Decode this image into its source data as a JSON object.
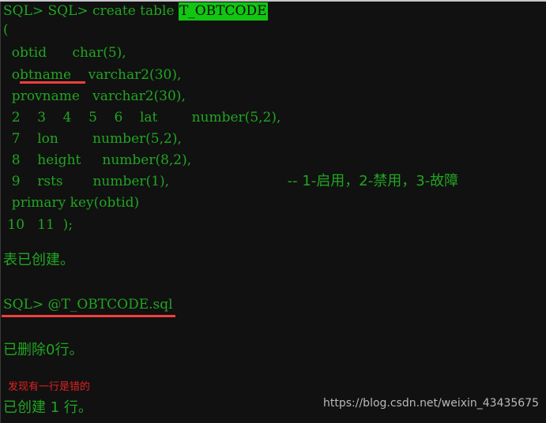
{
  "terminal": {
    "background_color": "#111111",
    "text_color": "#21a521",
    "highlight_bg_color": "#12c512",
    "highlight_fg_color": "#0c0c0c",
    "annotation_color": "#e02222",
    "underline_color": "#f0403c",
    "watermark_color": "#b9b9b9"
  },
  "lines": {
    "l1_prefix": "SQL> SQL> create table ",
    "l1_highlight": "T_OBTCODE",
    "l2": "(",
    "l3": "  obtid      char(5),",
    "l4_name": "  obtname",
    "l4_type": "    varchar2(30),",
    "l5": "  provname   varchar2(30),",
    "l6": "  2    3    4    5    6    lat        number(5,2),",
    "l7": "  7    lon        number(5,2),",
    "l8": "  8    height     number(8,2),",
    "l9_code": "  9    rsts       number(1),",
    "l9_comment": "     -- 1-启用，2-禁用，3-故障",
    "l10": "  primary key(obtid)",
    "l11": " 10   11  );",
    "l12": "表已创建。",
    "l13": "SQL> @T_OBTCODE.sql",
    "l14": "已删除0行。",
    "l15": "已创建 1 行。"
  },
  "annotations": {
    "error_note": "发现有一行是错的"
  },
  "watermark": {
    "url": "https://blog.csdn.net/weixin_43435675"
  }
}
